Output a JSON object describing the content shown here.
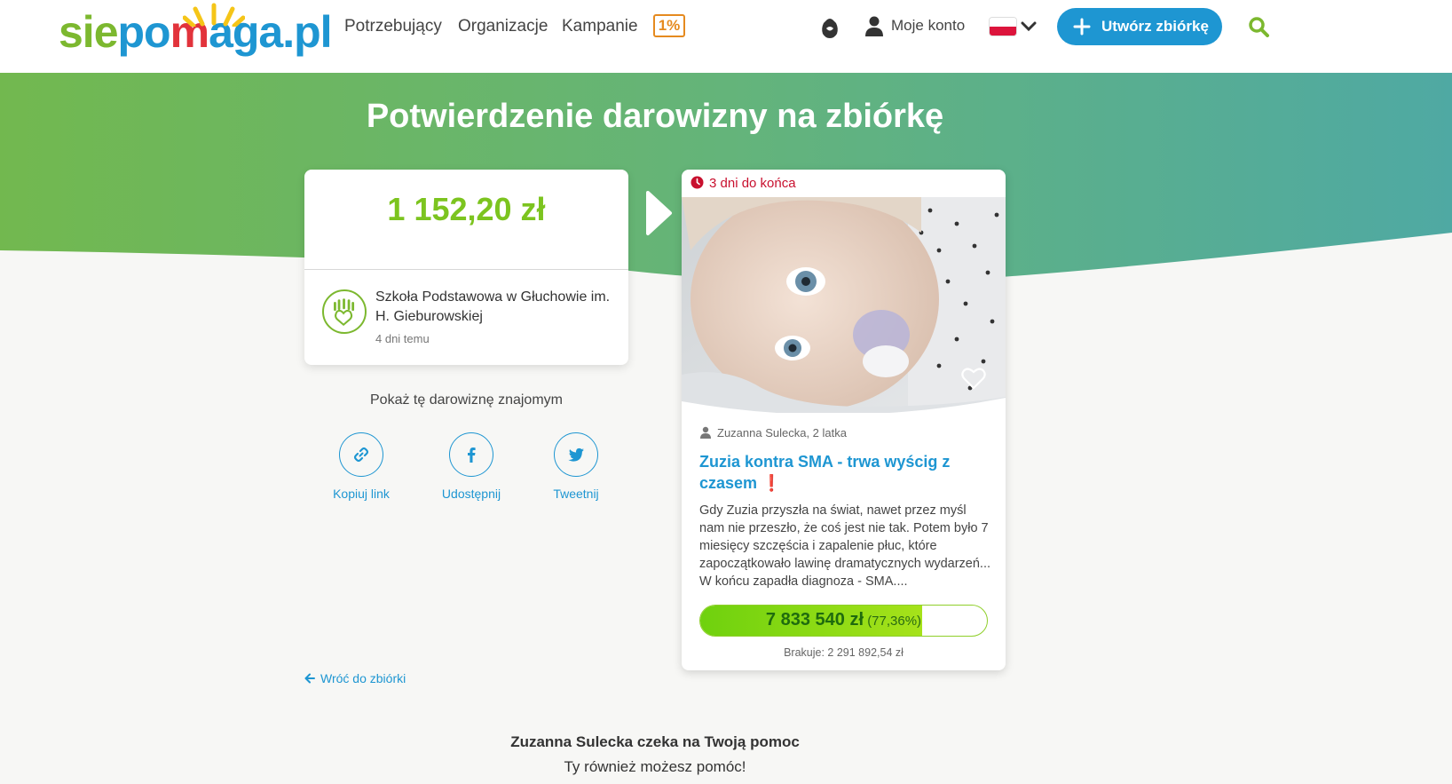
{
  "header": {
    "logo": {
      "part1": "sie",
      "part2": "po",
      "part3": "m",
      "part4": "aga.pl"
    },
    "nav": [
      "Potrzebujący",
      "Organizacje",
      "Kampanie"
    ],
    "one_percent": "1%",
    "account_label": "Moje konto",
    "language": "pl",
    "create_button": "Utwórz zbiórkę"
  },
  "page": {
    "title": "Potwierdzenie darowizny na zbiórkę"
  },
  "donation": {
    "amount": "1 152,20 zł",
    "org_name": "Szkoła Podstawowa w Głuchowie im. H. Gieburowskiej",
    "time_ago": "4 dni temu"
  },
  "share": {
    "title": "Pokaż tę darowiznę znajomym",
    "copy_link": "Kopiuj link",
    "share": "Udostępnij",
    "tweet": "Tweetnij"
  },
  "back_link": "Wróć do zbiórki",
  "campaign": {
    "deadline": "3 dni do końca",
    "beneficiary": "Zuzanna Sulecka, 2 latka",
    "title": "Zuzia kontra SMA - trwa wyścig z czasem",
    "title_mark": "❗",
    "description": "Gdy Zuzia przyszła na świat, nawet przez myśl nam nie przeszło, że coś jest nie tak. Potem było 7 miesięcy szczęścia i zapalenie płuc, które zapoczątkowało lawinę dramatycznych wydarzeń... W końcu zapadła diagnoza - SMA....",
    "raised": "7 833 540 zł",
    "percent_label": "(77,36%)",
    "progress_fraction": 0.7736,
    "missing": "Brakuje: 2 291 892,54 zł"
  },
  "bottom": {
    "title": "Zuzanna Sulecka czeka na Twoją pomoc",
    "subtitle": "Ty również możesz pomóc!"
  },
  "colors": {
    "brand_green": "#7cb82f",
    "brand_blue": "#1e96d2",
    "deadline_red": "#c8102e"
  }
}
